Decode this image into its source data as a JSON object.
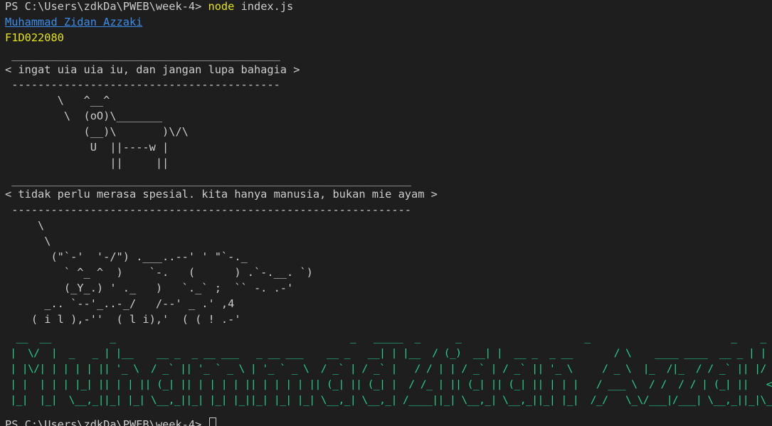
{
  "terminal": {
    "prompt_path": "PS C:\\Users\\zdkDa\\PWEB\\week-4>",
    "command_program": "node",
    "command_args": "index.js",
    "name": "Muhammad Zidan Azzaki",
    "nim": "F1D022080",
    "cow1": {
      "top_border": " _________________________________________",
      "message": "< ingat uia uia iu, dan jangan lupa bahagia >",
      "bottom_border": " -----------------------------------------",
      "art": [
        "        \\   ^__^",
        "         \\  (oO)\\_______",
        "            (__)\\       )\\/\\",
        "             U  ||----w |",
        "                ||     ||"
      ]
    },
    "cow2": {
      "top_border": " _____________________________________________________________",
      "message": "< tidak perlu merasa spesial. kita hanya manusia, bukan mie ayam >",
      "bottom_border": " -------------------------------------------------------------",
      "art": [
        "     \\",
        "      \\",
        "       (\"`-'  '-/\") .___..--' ' \"`-._",
        "         ` ^_ ^  )    `-.   (      ) .`-.__. `)",
        "         (_Y_.) ' ._   )   `._` ;  `` -. .-'",
        "      _.. `--'_..-_/   /--' _ .' ,4",
        "    ( i l ),-''  ( l i),'  ( ( ! .-'"
      ]
    },
    "figlet": [
      "  __  __          _                                        _   _____  _      _                     _                        _    _ ",
      " |  \\/  |  _   _ | |__    __ _  _ __ ___   _ __ ___    __ _   __| | |__  / (_)  __| |  __ _  _ __       / \\    ____ ____  __ _ | | __(_)",
      " | |\\/| | | | | || '_ \\  / _` || '_ ` _ \\ | '_ ` _ \\  / _` | / _` |   / / | | / _` | / _` || '_ \\     / _ \\  |_  /|_  / / _` || |/ /| |",
      " | |  | | | |_| || | | || (_| || | | | | || | | | | || (_| || (_| |  / /_ | || (_| || (_| || | | |   / ___ \\  / /  / / | (_| ||   < | |",
      " |_|  |_|  \\__,_||_| |_| \\__,_||_| |_| |_||_| |_| |_| \\__,_| \\__,_| /____||_| \\__,_| \\__,_||_| |_|  /_/   \\_\\/___|/___| \\__,_||_|\\_\\|_|"
    ],
    "last_prompt": "PS C:\\Users\\zdkDa\\PWEB\\week-4>"
  }
}
